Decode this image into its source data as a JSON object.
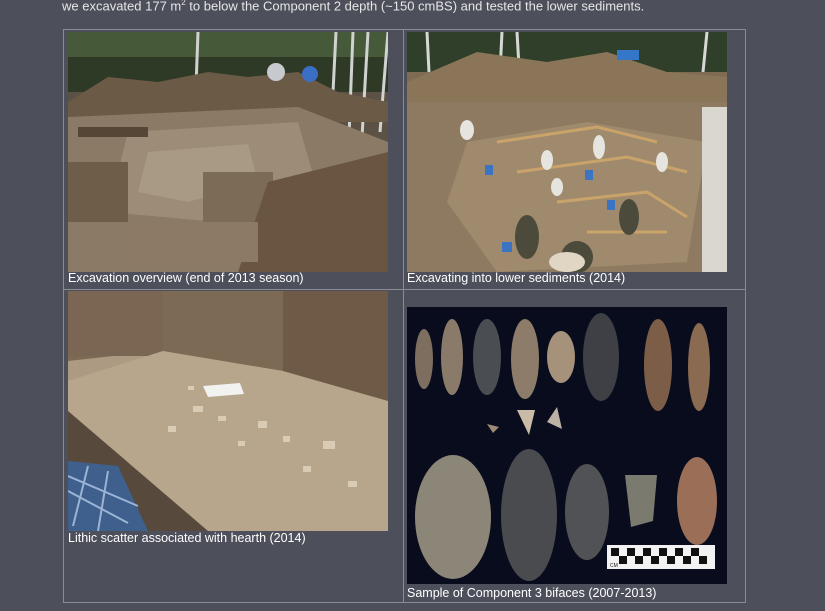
{
  "intro": {
    "text_before": "we excavated 177 m",
    "superscript": "2",
    "text_after": " to below the Component 2 depth (~150 cmBS) and tested the lower sediments."
  },
  "figures": [
    {
      "caption": "Excavation overview (end of 2013 season)"
    },
    {
      "caption": "Excavating into lower sediments (2014)"
    },
    {
      "caption": "Lithic scatter associated with hearth (2014)"
    },
    {
      "caption": "Sample of Component 3 bifaces (2007-2013)"
    }
  ],
  "scale_bar": {
    "label": "CM"
  }
}
